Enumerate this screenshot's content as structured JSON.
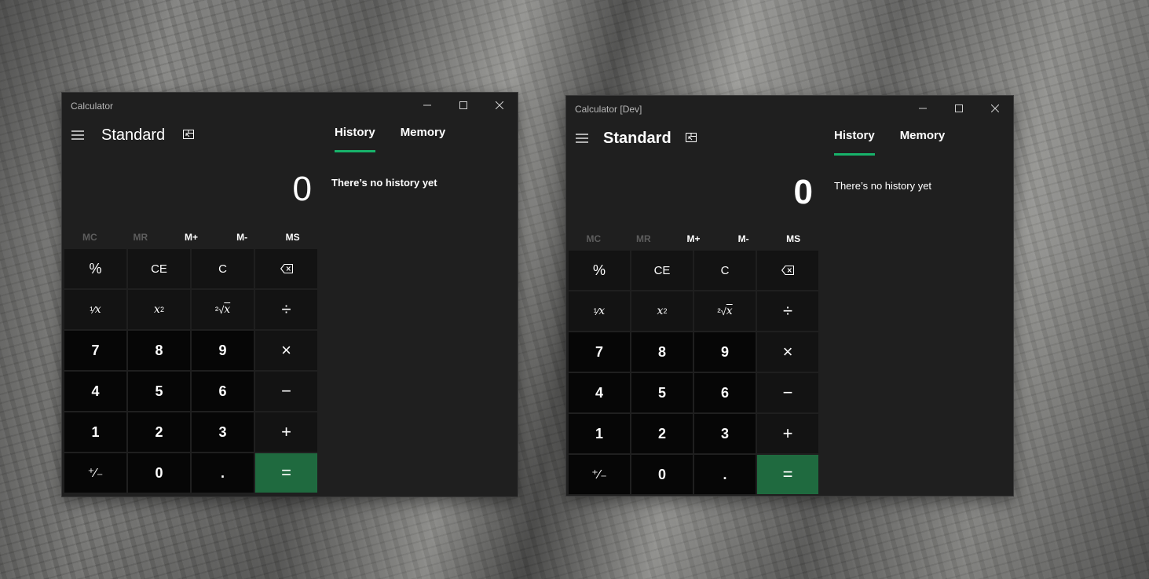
{
  "windows": [
    {
      "title": "Calculator",
      "mode": "Standard",
      "display": "0",
      "tabs": {
        "history": "History",
        "memory": "Memory"
      },
      "history_empty": "There’s no history yet",
      "memory": [
        "MC",
        "MR",
        "M+",
        "M-",
        "MS"
      ],
      "keys": [
        "%",
        "CE",
        "C",
        "backspace-icon",
        "¹⁄x",
        "x²",
        "²√x",
        "÷",
        "7",
        "8",
        "9",
        "×",
        "4",
        "5",
        "6",
        "−",
        "1",
        "2",
        "3",
        "+",
        "⁺⁄₋",
        "0",
        ".",
        "="
      ]
    },
    {
      "title": "Calculator [Dev]",
      "mode": "Standard",
      "display": "0",
      "tabs": {
        "history": "History",
        "memory": "Memory"
      },
      "history_empty": "There’s no history yet",
      "memory": [
        "MC",
        "MR",
        "M+",
        "M-",
        "MS"
      ]
    }
  ],
  "icons": {
    "minimize": "minimize-icon",
    "maximize": "maximize-icon",
    "close": "close-icon",
    "menu": "hamburger-menu-icon",
    "always_on_top": "keep-on-top-icon",
    "backspace": "backspace-icon"
  },
  "colors": {
    "window_bg": "#1f1f1f",
    "number_key_bg": "#060606",
    "function_key_bg": "#131313",
    "equals_bg": "#1f6a3f",
    "accent": "#17b26a",
    "disabled_text": "#5d5d5d"
  },
  "key_labels": {
    "percent": "%",
    "ce": "CE",
    "c": "C",
    "reciprocal_num": "¹⁄",
    "reciprocal_x": "x",
    "square_x": "x",
    "square_sup": "2",
    "sqrt_idx": "²√",
    "sqrt_x": "x",
    "divide": "÷",
    "multiply": "×",
    "minus": "−",
    "plus": "+",
    "n7": "7",
    "n8": "8",
    "n9": "9",
    "n4": "4",
    "n5": "5",
    "n6": "6",
    "n1": "1",
    "n2": "2",
    "n3": "3",
    "negate": "⁺⁄₋",
    "n0": "0",
    "decimal": ".",
    "equals": "="
  }
}
